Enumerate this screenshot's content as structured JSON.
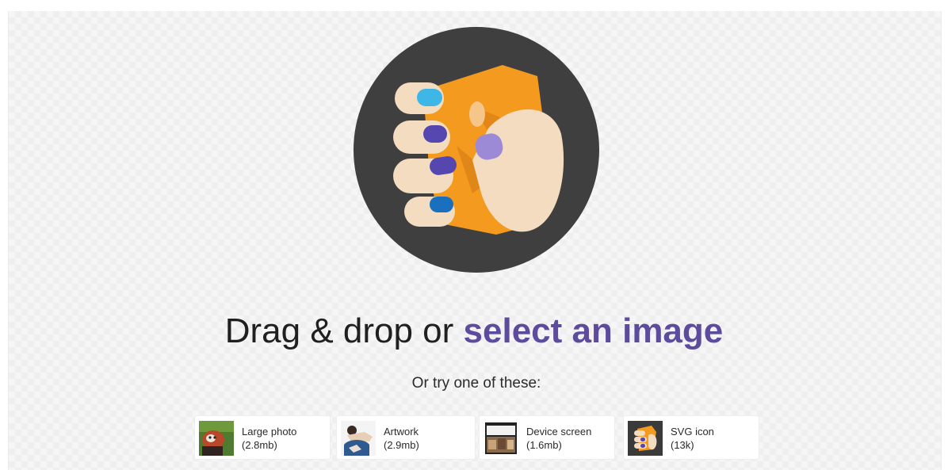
{
  "headline": {
    "prefix": "Drag & drop or",
    "link": "select an image"
  },
  "subheading": "Or try one of these:",
  "logo": {
    "icon": "hand-holding-image-logo-icon",
    "colors": {
      "circle": "#3f3f3f",
      "paper": "#f39a1f",
      "skin": "#f3dcc0",
      "nail_blue": "#3eb6e6",
      "nail_purple": "#5546b0"
    }
  },
  "accent_color": "#5d4b9e",
  "samples": [
    {
      "icon": "large-photo-thumbnail",
      "name": "Large photo",
      "size": "(2.8mb)"
    },
    {
      "icon": "artwork-thumbnail",
      "name": "Artwork",
      "size": "(2.9mb)"
    },
    {
      "icon": "device-screen-thumbnail",
      "name": "Device screen",
      "size": "(1.6mb)"
    },
    {
      "icon": "svg-icon-thumbnail",
      "name": "SVG icon",
      "size": "(13k)"
    }
  ]
}
